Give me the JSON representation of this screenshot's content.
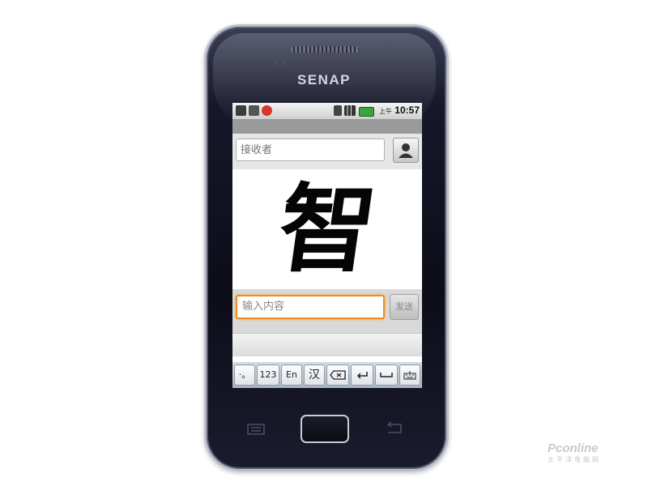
{
  "device": {
    "brand": "SENAP"
  },
  "status_bar": {
    "left_icons": [
      "android-icon",
      "usb-icon",
      "notification-icon"
    ],
    "right_icons": [
      "sim-icon",
      "signal-bars-icon",
      "battery-icon"
    ],
    "am_pm": "上午",
    "time": "10:57"
  },
  "recipient": {
    "placeholder": "接收者",
    "contact_button_icon": "contact-person-icon"
  },
  "handwriting": {
    "character": "智"
  },
  "compose": {
    "placeholder": "输入内容",
    "send_label": "发送"
  },
  "keyboard": {
    "keys": [
      {
        "label": "·。",
        "icon": "punctuation-icon"
      },
      {
        "label": "123",
        "icon": ""
      },
      {
        "label": "En",
        "icon": ""
      },
      {
        "label": "汉",
        "icon": ""
      },
      {
        "label": "",
        "icon": "backspace-icon"
      },
      {
        "label": "",
        "icon": "enter-icon"
      },
      {
        "label": "",
        "icon": "space-icon"
      },
      {
        "label": "",
        "icon": "keyboard-switch-icon"
      }
    ]
  },
  "hardware_buttons": [
    "menu-icon",
    "home-button",
    "back-icon"
  ],
  "watermark": {
    "text": "Pconline",
    "sub": "太平洋电脑网"
  },
  "colors": {
    "input_focus": "#f08a1c",
    "phone_body": "#0c0d18",
    "bezel": "#b9bccb"
  }
}
